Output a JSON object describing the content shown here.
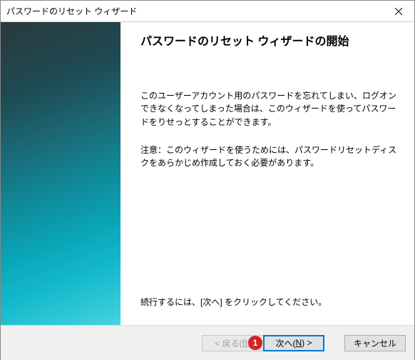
{
  "titlebar": {
    "title": "パスワードのリセット ウィザード"
  },
  "main": {
    "heading": "パスワードのリセット ウィザードの開始",
    "paragraph1": "このユーザーアカウント用のパスワードを忘れてしまい、ログオンできなくなってしまった場合は、このウィザードを使ってパスワードをりせっとすることができます。",
    "paragraph2": "注意：このウィザードを使うためには、パスワードリセットディスクをあらかじめ作成しておく必要があります。",
    "continue": "続行するには、[次へ] をクリックしてください。"
  },
  "footer": {
    "back_prefix": "< 戻る(",
    "back_key": "B",
    "back_suffix": ")",
    "next_prefix": "次へ(",
    "next_key": "N",
    "next_suffix": ") >",
    "cancel": "キャンセル"
  },
  "annotation": {
    "marker1": "1"
  }
}
